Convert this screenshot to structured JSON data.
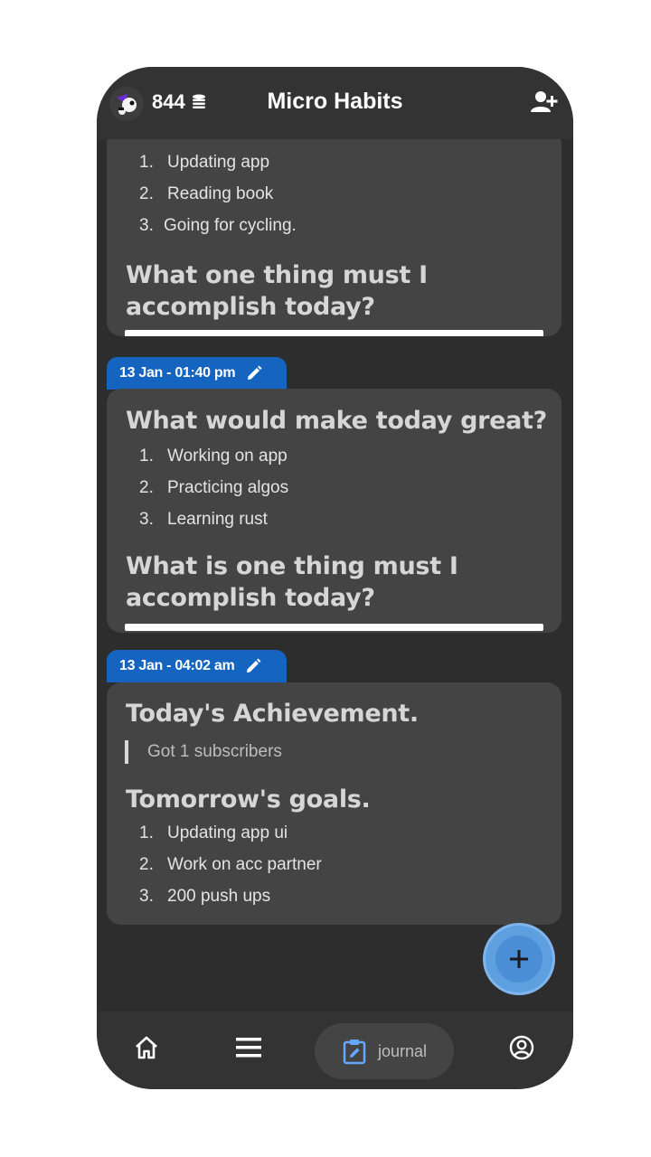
{
  "header": {
    "coins": "844",
    "title": "Micro Habits"
  },
  "entries": [
    {
      "items": [
        {
          "num": "1.",
          "text": "Updating app"
        },
        {
          "num": "2.",
          "text": "Reading book"
        },
        {
          "num": "3.",
          "text": "Going for cycling."
        }
      ],
      "question": "What one thing must I accomplish today?"
    },
    {
      "date": "13 Jan - 01:40 pm",
      "question1": "What would make today great?",
      "items": [
        {
          "num": "1.",
          "text": "Working on app"
        },
        {
          "num": "2.",
          "text": "Practicing algos"
        },
        {
          "num": "3.",
          "text": "Learning rust"
        }
      ],
      "question2": "What is one thing must I accomplish today?"
    },
    {
      "date": "13 Jan - 04:02 am",
      "heading1": "Today's Achievement.",
      "quote": "Got 1 subscribers",
      "heading2": "Tomorrow's goals.",
      "items": [
        {
          "num": "1.",
          "text": "Updating app ui"
        },
        {
          "num": "2.",
          "text": "Work on acc partner"
        },
        {
          "num": "3.",
          "text": "200 push ups"
        }
      ]
    }
  ],
  "fab": {
    "icon": "plus-icon"
  },
  "bottom_nav": {
    "journal_label": "journal",
    "icons": [
      "home-icon",
      "menu-icon",
      "journal-icon",
      "profile-icon"
    ]
  },
  "colors": {
    "accent": "#1565c0",
    "fab": "#5e9fe0",
    "background": "#2d2d2d",
    "card": "#444444"
  }
}
